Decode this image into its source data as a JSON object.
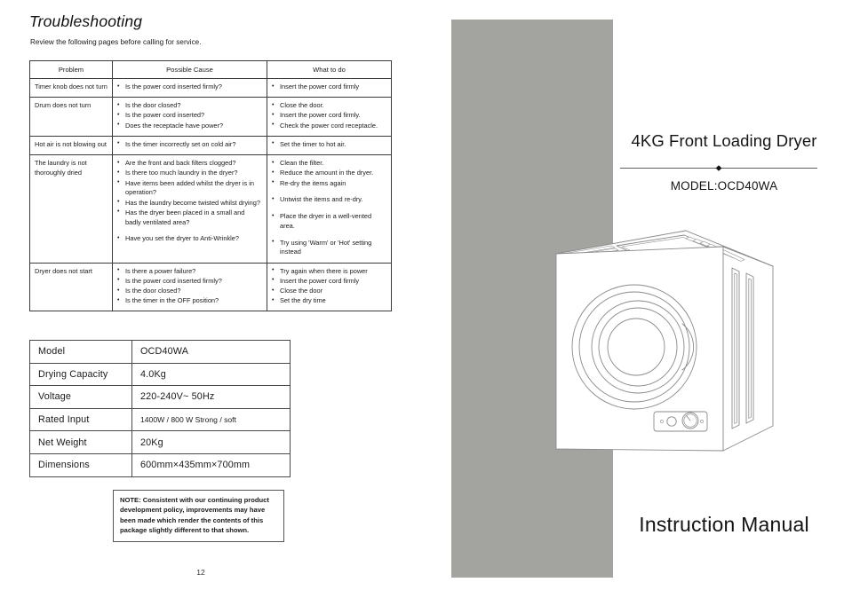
{
  "left_page": {
    "title": "Troubleshooting",
    "subtitle": "Review the following pages before calling for service.",
    "page_number": "12",
    "troubleshooting_table": {
      "headers": [
        "Problem",
        "Possible Cause",
        "What to do"
      ],
      "rows": [
        {
          "problem": "Timer knob does not turn",
          "causes": [
            "Is the power cord inserted firmly?"
          ],
          "actions": [
            "Insert the power cord firmly"
          ]
        },
        {
          "problem": "Drum does not turn",
          "causes": [
            "Is the door closed?",
            "Is the power cord inserted?",
            "Does the receptacle have power?"
          ],
          "actions": [
            "Close the door.",
            "Insert the power cord firmly.",
            "Check the power cord receptacle."
          ]
        },
        {
          "problem": "Hot air is not blowing out",
          "causes": [
            "Is the timer incorrectly set on cold air?"
          ],
          "actions": [
            "Set the timer to hot air."
          ]
        },
        {
          "problem": "The laundry is not thoroughly dried",
          "causes": [
            "Are the front and back filters clogged?",
            "Is there too much laundry in the dryer?",
            "Have items been added whilst the dryer is in operation?",
            "Has the laundry become twisted whilst drying?",
            "Has the dryer been placed in a small and badly ventilated area?",
            "Have you set the dryer to Anti-Wrinkle?"
          ],
          "actions": [
            "Clean the filter.",
            "Reduce the amount in the dryer.",
            "Re-dry the items again",
            "Untwist the items and re-dry.",
            "Place the dryer in a well-vented area.",
            "Try using 'Warm' or 'Hot' setting instead"
          ]
        },
        {
          "problem": "Dryer does not start",
          "causes": [
            "Is there a power failure?",
            "Is the power cord inserted firmly?",
            "Is the door closed?",
            "Is the timer in the OFF position?"
          ],
          "actions": [
            "Try again when there is power",
            "Insert the power cord firmly",
            "Close the door",
            "Set the dry time"
          ]
        }
      ]
    },
    "specifications": [
      {
        "label": "Model",
        "value": "OCD40WA"
      },
      {
        "label": "Drying Capacity",
        "value": "4.0Kg"
      },
      {
        "label": "Voltage",
        "value": "220-240V~  50Hz"
      },
      {
        "label": "Rated Input",
        "value": "1400W / 800 W  Strong / soft"
      },
      {
        "label": "Net Weight",
        "value": "20Kg"
      },
      {
        "label": "Dimensions",
        "value": "600mm×435mm×700mm"
      }
    ],
    "note": "NOTE: Consistent with our continuing product development policy, improvements may have been made which render the contents of this package slightly different to that shown."
  },
  "right_page": {
    "cover_title": "4KG Front Loading Dryer",
    "cover_model": "MODEL:OCD40WA",
    "cover_footer": "Instruction Manual",
    "gray_panel_color": "#a3a49f",
    "illustration": "front-loading-dryer-line-drawing"
  }
}
